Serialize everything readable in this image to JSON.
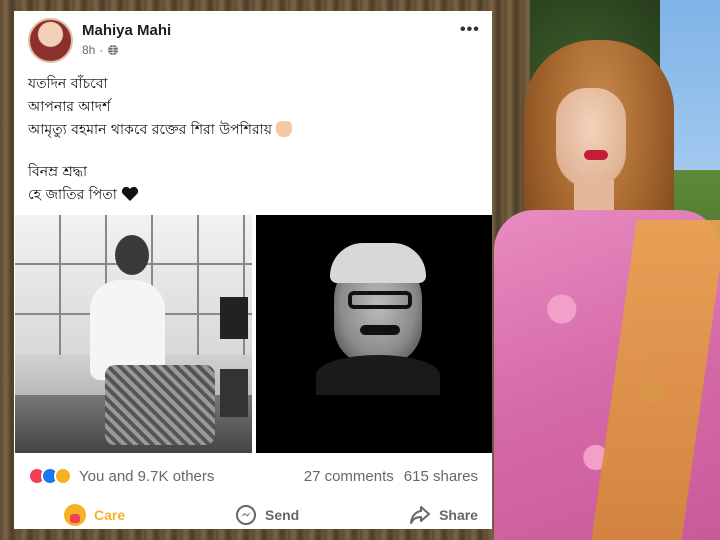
{
  "post": {
    "author": "Mahiya Mahi",
    "time": "8h",
    "text_lines": [
      "যতদিন বাঁচবো",
      "আপনার আদর্শ",
      "আমৃত্যু বহমান থাকবে রক্তের শিরা উপশিরায়",
      "বিনম্র শ্রদ্ধা",
      "হে জাতির পিতা"
    ]
  },
  "stats": {
    "reactions_text": "You and 9.7K others",
    "comments": "27 comments",
    "shares": "615 shares"
  },
  "actions": {
    "care": "Care",
    "send": "Send",
    "share": "Share"
  },
  "colors": {
    "care": "#f7b125",
    "love": "#f33e58",
    "like": "#1877f2",
    "muted_text": "#65676b"
  },
  "icons": {
    "privacy": "globe-icon",
    "menu": "more-icon",
    "send": "messenger-icon",
    "share": "share-arrow-icon",
    "care": "care-emoji-icon"
  }
}
